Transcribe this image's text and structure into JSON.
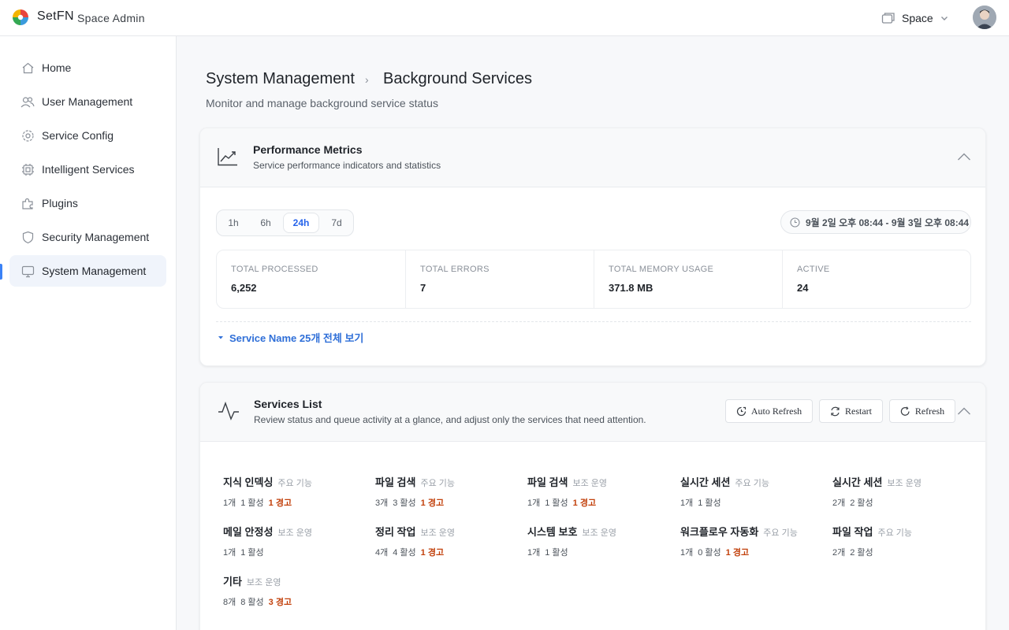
{
  "app": {
    "brand": "SetFN",
    "subtitle": "Space Admin",
    "space_label": "Space"
  },
  "sidebar": {
    "items": [
      {
        "label": "Home",
        "icon": "home-icon"
      },
      {
        "label": "User Management",
        "icon": "users-icon"
      },
      {
        "label": "Service Config",
        "icon": "gear-icon"
      },
      {
        "label": "Intelligent Services",
        "icon": "chip-icon"
      },
      {
        "label": "Plugins",
        "icon": "puzzle-icon"
      },
      {
        "label": "Security Management",
        "icon": "shield-icon"
      },
      {
        "label": "System Management",
        "icon": "monitor-icon",
        "active": true
      }
    ]
  },
  "header": {
    "breadcrumb": [
      "System Management",
      "Background Services"
    ],
    "subtitle": "Monitor and manage background service status"
  },
  "performance": {
    "title": "Performance Metrics",
    "description": "Service performance indicators and statistics",
    "ranges": [
      "1h",
      "6h",
      "24h",
      "7d"
    ],
    "selected_range": "24h",
    "time_range": "9월 2일 오후 08:44 - 9월 3일 오후 08:44",
    "stats": [
      {
        "label": "TOTAL PROCESSED",
        "value": "6,252"
      },
      {
        "label": "TOTAL ERRORS",
        "value": "7"
      },
      {
        "label": "TOTAL MEMORY USAGE",
        "value": "371.8 MB"
      },
      {
        "label": "ACTIVE",
        "value": "24"
      }
    ],
    "expand_label": "Service Name 25개 전체 보기"
  },
  "services": {
    "title": "Services List",
    "description": "Review status and queue activity at a glance, and adjust only the services that need attention.",
    "buttons": {
      "auto_refresh": "Auto Refresh",
      "restart": "Restart",
      "refresh": "Refresh"
    },
    "items": [
      {
        "name": "지식 인덱싱",
        "tag": "주요 기능",
        "count": "1개",
        "active": "1 활성",
        "warn": "1 경고"
      },
      {
        "name": "파일 검색",
        "tag": "주요 기능",
        "count": "3개",
        "active": "3 활성",
        "warn": "1 경고"
      },
      {
        "name": "파일 검색",
        "tag": "보조 운영",
        "count": "1개",
        "active": "1 활성",
        "warn": "1 경고"
      },
      {
        "name": "실시간 세션",
        "tag": "주요 기능",
        "count": "1개",
        "active": "1 활성",
        "warn": ""
      },
      {
        "name": "실시간 세션",
        "tag": "보조 운영",
        "count": "2개",
        "active": "2 활성",
        "warn": ""
      },
      {
        "name": "메일 안정성",
        "tag": "보조 운영",
        "count": "1개",
        "active": "1 활성",
        "warn": ""
      },
      {
        "name": "정리 작업",
        "tag": "보조 운영",
        "count": "4개",
        "active": "4 활성",
        "warn": "1 경고"
      },
      {
        "name": "시스템 보호",
        "tag": "보조 운영",
        "count": "1개",
        "active": "1 활성",
        "warn": ""
      },
      {
        "name": "워크플로우 자동화",
        "tag": "주요 기능",
        "count": "1개",
        "active": "0 활성",
        "warn": "1 경고"
      },
      {
        "name": "파일 작업",
        "tag": "주요 기능",
        "count": "2개",
        "active": "2 활성",
        "warn": ""
      },
      {
        "name": "기타",
        "tag": "보조 운영",
        "count": "8개",
        "active": "8 활성",
        "warn": "3 경고"
      }
    ]
  },
  "colors": {
    "accent": "#2563eb",
    "warning": "#c2410c",
    "sidebar_active": "#f0f4fb"
  }
}
